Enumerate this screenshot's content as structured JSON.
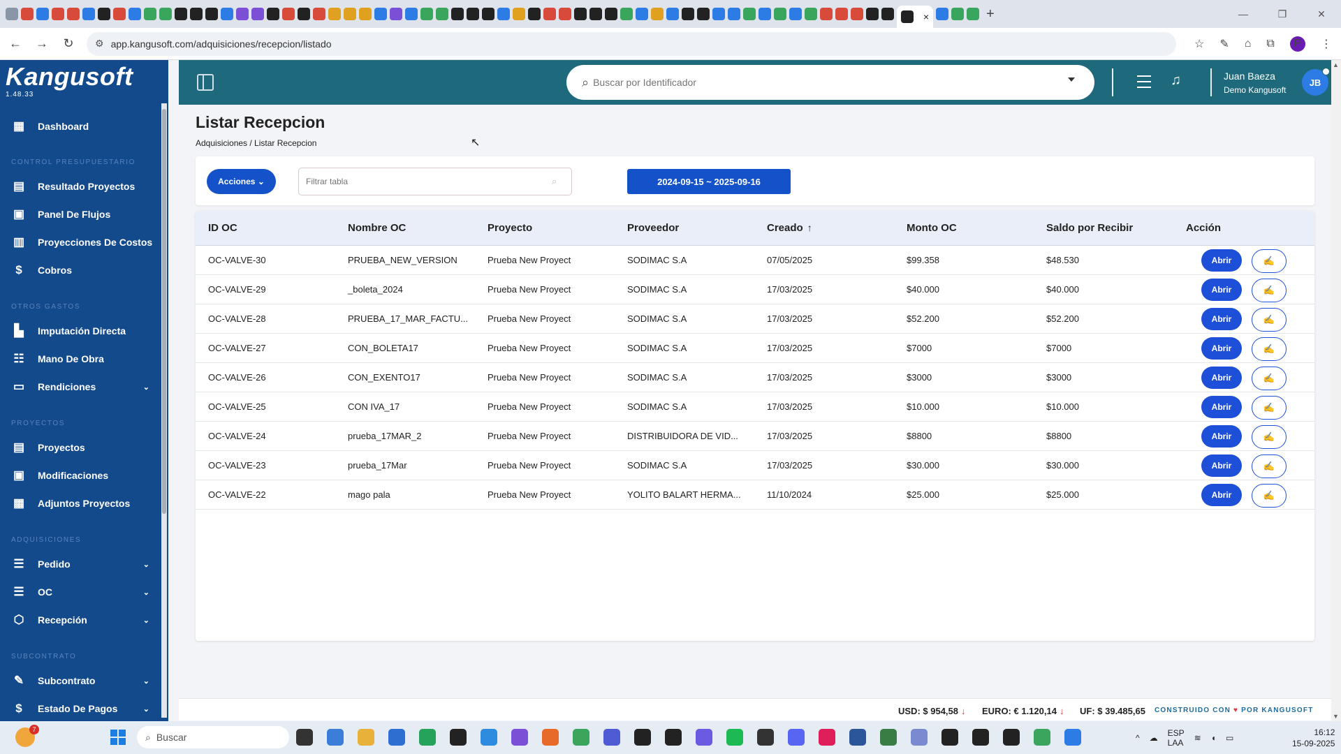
{
  "browser": {
    "tab_close": "×",
    "new_tab": "+",
    "url": "app.kangusoft.com/adquisiciones/recepcion/listado",
    "profile_initial": "P"
  },
  "brand": {
    "name": "Kangusoft",
    "version": "1.48.33"
  },
  "sidebar": {
    "dashboard": "Dashboard",
    "sections": {
      "control": "CONTROL PRESUPUESTARIO",
      "otros": "OTROS GASTOS",
      "proyectos": "PROYECTOS",
      "adquisiciones": "ADQUISICIONES",
      "subcontrato": "SUBCONTRATO"
    },
    "items": {
      "resultado": "Resultado Proyectos",
      "panel": "Panel De Flujos",
      "proyecciones": "Proyecciones De Costos",
      "cobros": "Cobros",
      "imputacion": "Imputación Directa",
      "mano": "Mano De Obra",
      "rendiciones": "Rendiciones",
      "proyectos": "Proyectos",
      "modificaciones": "Modificaciones",
      "adjuntos": "Adjuntos Proyectos",
      "pedido": "Pedido",
      "oc": "OC",
      "recepcion": "Recepción",
      "subcontrato": "Subcontrato",
      "estado": "Estado De Pagos"
    }
  },
  "header": {
    "search_placeholder": "Buscar por Identificador",
    "user_name": "Juan Baeza",
    "user_org": "Demo Kangusoft",
    "avatar_initials": "JB"
  },
  "page": {
    "title": "Listar Recepcion",
    "breadcrumb": "Adquisiciones / Listar Recepcion"
  },
  "filters": {
    "acciones_label": "Acciones ⌄",
    "filter_placeholder": "Filtrar tabla",
    "date_range": "2024-09-15 ~ 2025-09-16"
  },
  "table": {
    "columns": [
      "ID OC",
      "Nombre OC",
      "Proyecto",
      "Proveedor",
      "Creado",
      "Monto OC",
      "Saldo por Recibir",
      "Acción"
    ],
    "sort_indicator": "↑",
    "abrir_label": "Abrir",
    "rows": [
      [
        "OC-VALVE-30",
        "PRUEBA_NEW_VERSION",
        "Prueba New Proyect",
        "SODIMAC S.A",
        "07/05/2025",
        "$99.358",
        "$48.530"
      ],
      [
        "OC-VALVE-29",
        "_boleta_2024",
        "Prueba New Proyect",
        "SODIMAC S.A",
        "17/03/2025",
        "$40.000",
        "$40.000"
      ],
      [
        "OC-VALVE-28",
        "PRUEBA_17_MAR_FACTU...",
        "Prueba New Proyect",
        "SODIMAC S.A",
        "17/03/2025",
        "$52.200",
        "$52.200"
      ],
      [
        "OC-VALVE-27",
        "CON_BOLETA17",
        "Prueba New Proyect",
        "SODIMAC S.A",
        "17/03/2025",
        "$7000",
        "$7000"
      ],
      [
        "OC-VALVE-26",
        "CON_EXENTO17",
        "Prueba New Proyect",
        "SODIMAC S.A",
        "17/03/2025",
        "$3000",
        "$3000"
      ],
      [
        "OC-VALVE-25",
        "CON IVA_17",
        "Prueba New Proyect",
        "SODIMAC S.A",
        "17/03/2025",
        "$10.000",
        "$10.000"
      ],
      [
        "OC-VALVE-24",
        "prueba_17MAR_2",
        "Prueba New Proyect",
        "DISTRIBUIDORA DE VID...",
        "17/03/2025",
        "$8800",
        "$8800"
      ],
      [
        "OC-VALVE-23",
        "prueba_17Mar",
        "Prueba New Proyect",
        "SODIMAC S.A",
        "17/03/2025",
        "$30.000",
        "$30.000"
      ],
      [
        "OC-VALVE-22",
        "mago pala",
        "Prueba New Proyect",
        "YOLITO BALART HERMA...",
        "11/10/2024",
        "$25.000",
        "$25.000"
      ]
    ]
  },
  "footer": {
    "usd": "USD: $ 954,58",
    "euro": "EURO: € 1.120,14",
    "uf": "UF: $ 39.485,65",
    "credit_left": "CONSTRUIDO CON",
    "credit_right": "POR KANGUSOFT"
  },
  "taskbar": {
    "search": "Buscar",
    "lang": "ESP",
    "layout": "LAA",
    "time": "16:12",
    "date": "15-09-2025"
  },
  "colors": {
    "sidebar": "#134a8c",
    "topbar": "#1e6a7c",
    "primary_button": "#1352c8"
  }
}
